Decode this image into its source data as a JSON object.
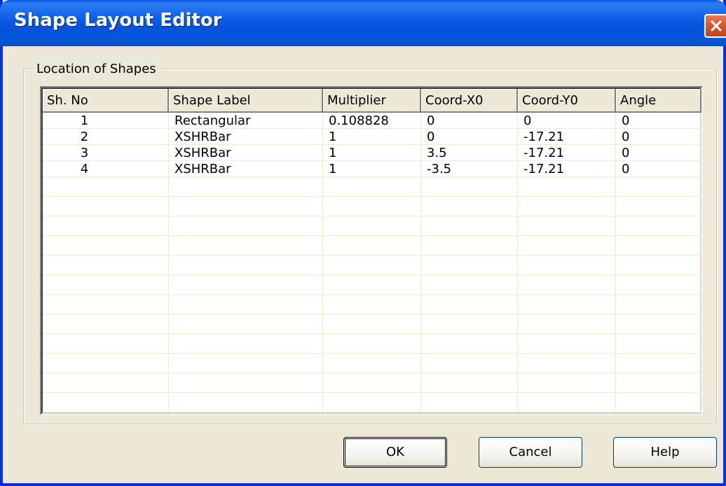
{
  "window": {
    "title": "Shape Layout Editor"
  },
  "groupbox": {
    "label": "Location of Shapes"
  },
  "table": {
    "columns": [
      "Sh. No",
      "Shape Label",
      "Multiplier",
      "Coord-X0",
      "Coord-Y0",
      "Angle"
    ],
    "rows": [
      [
        "1",
        "Rectangular",
        "0.108828",
        "0",
        "0",
        "0"
      ],
      [
        "2",
        "XSHRBar",
        "1",
        "0",
        "-17.21",
        "0"
      ],
      [
        "3",
        "XSHRBar",
        "1",
        "3.5",
        "-17.21",
        "0"
      ],
      [
        "4",
        "XSHRBar",
        "1",
        "-3.5",
        "-17.21",
        "0"
      ]
    ]
  },
  "buttons": {
    "ok": "OK",
    "cancel": "Cancel",
    "help": "Help"
  },
  "colors": {
    "title_bar": "#0a5ae9",
    "dialog_bg": "#ece9d8",
    "close_button": "#d9542c"
  }
}
